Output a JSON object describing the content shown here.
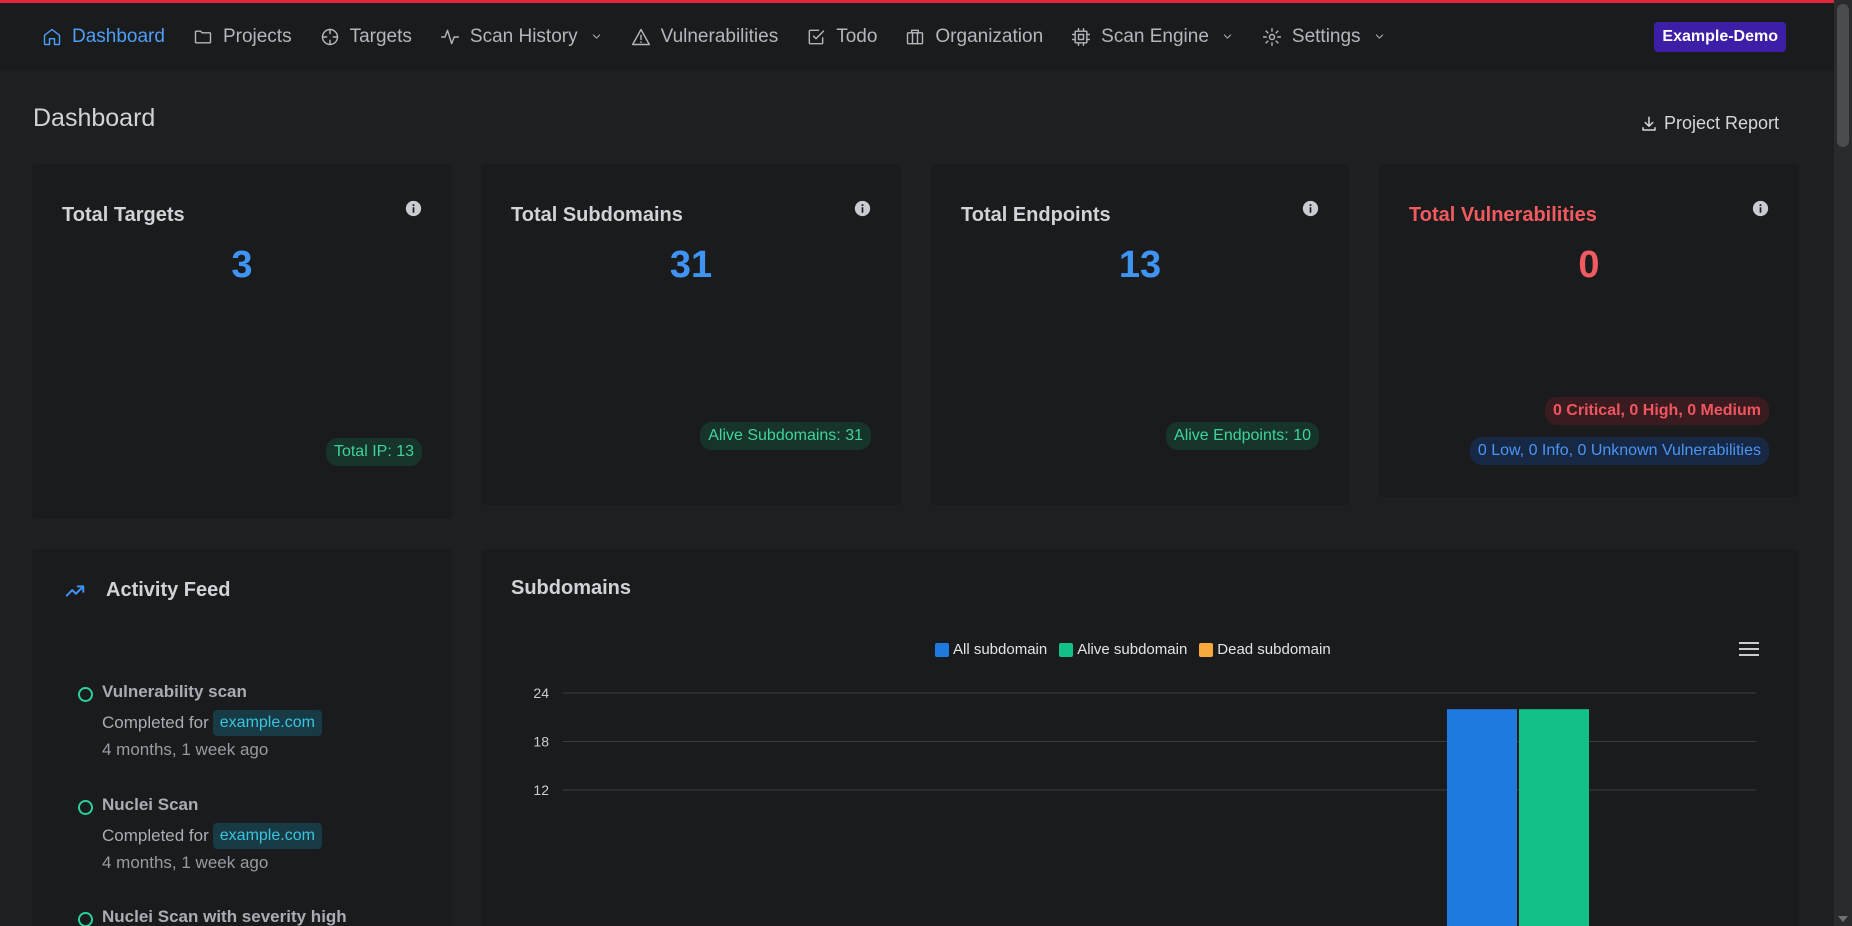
{
  "nav": {
    "items": [
      {
        "label": "Dashboard",
        "icon": "home-icon"
      },
      {
        "label": "Projects",
        "icon": "folder-icon"
      },
      {
        "label": "Targets",
        "icon": "crosshair-icon"
      },
      {
        "label": "Scan History",
        "icon": "activity-icon"
      },
      {
        "label": "Vulnerabilities",
        "icon": "alert-triangle-icon"
      },
      {
        "label": "Todo",
        "icon": "check-square-icon"
      },
      {
        "label": "Organization",
        "icon": "briefcase-icon"
      },
      {
        "label": "Scan Engine",
        "icon": "cpu-icon"
      },
      {
        "label": "Settings",
        "icon": "gear-icon"
      }
    ],
    "org_badge": "Example-Demo"
  },
  "header": {
    "title": "Dashboard",
    "report_button": "Project Report"
  },
  "cards": {
    "targets": {
      "title": "Total Targets",
      "value": "3",
      "pill": "Total IP: 13"
    },
    "subdomains": {
      "title": "Total Subdomains",
      "value": "31",
      "pill": "Alive Subdomains: 31"
    },
    "endpoints": {
      "title": "Total Endpoints",
      "value": "13",
      "pill": "Alive Endpoints: 10"
    },
    "vulnerabilities": {
      "title": "Total Vulnerabilities",
      "value": "0",
      "pill_severe": "0 Critical, 0 High, 0 Medium",
      "pill_minor": "0 Low, 0 Info, 0 Unknown Vulnerabilities"
    }
  },
  "activity": {
    "title": "Activity Feed",
    "items": [
      {
        "title": "Vulnerability scan",
        "completed": "Completed for",
        "target": "example.com",
        "ago": "4 months, 1 week ago"
      },
      {
        "title": "Nuclei Scan",
        "completed": "Completed for",
        "target": "example.com",
        "ago": "4 months, 1 week ago"
      },
      {
        "title": "Nuclei Scan with severity high",
        "completed": "",
        "target": "",
        "ago": ""
      }
    ]
  },
  "colors": {
    "accent": "#3f93f2",
    "danger": "#f25a60",
    "success": "#2bd19a",
    "brand_line": "#e3263f",
    "org_badge": "#3d1fa7"
  },
  "chart_data": {
    "type": "bar",
    "title": "Subdomains",
    "legend_position": "top-center",
    "series": [
      {
        "name": "All subdomain",
        "color": "#1f7ae0",
        "values": [
          22
        ]
      },
      {
        "name": "Alive subdomain",
        "color": "#12c08a",
        "values": [
          22
        ]
      },
      {
        "name": "Dead subdomain",
        "color": "#f7a93b",
        "values": [
          0
        ]
      }
    ],
    "y_ticks": [
      24,
      18,
      12
    ],
    "ylim": [
      0,
      24
    ],
    "grid": true
  }
}
